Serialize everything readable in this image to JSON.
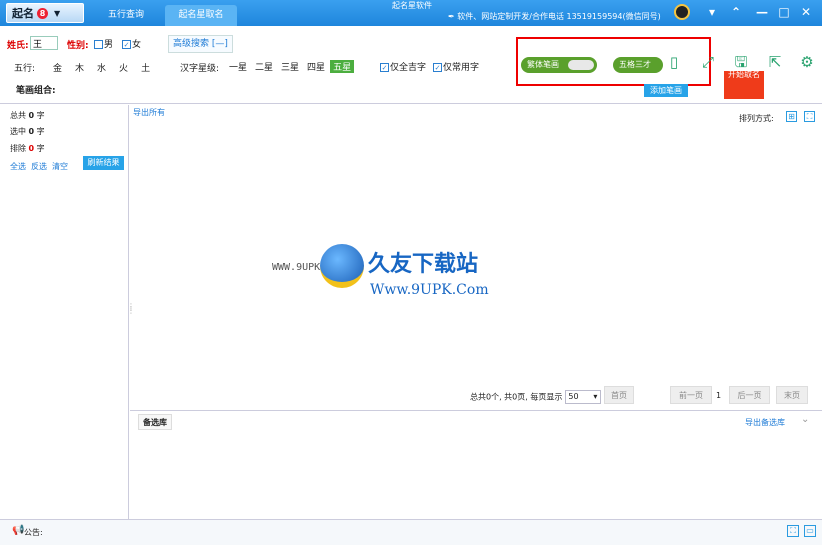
{
  "titlebar": {
    "logo_text": "起名",
    "logo_badge": "8",
    "tabs": [
      "五行查询",
      "起名星取名"
    ],
    "app_name": "起名星软件",
    "contact": "软件、网站定制开发/合作电话 13519159594(微信同号)",
    "controls": {
      "menu": "▾",
      "up": "⌃",
      "min": "—",
      "max": "□",
      "close": "✕"
    }
  },
  "form": {
    "surname_label": "姓氏:",
    "surname_value": "王",
    "gender_label": "性别:",
    "gender_male": "男",
    "gender_female": "女",
    "advanced": "高级搜索 [—]",
    "wuxing_label": "五行:",
    "wuxing": [
      "金",
      "木",
      "水",
      "火",
      "土"
    ],
    "star_label": "汉字星级:",
    "stars": [
      "一星",
      "二星",
      "三星",
      "四星",
      "五星"
    ],
    "selected_star": "五星",
    "only_auspicious": "仅全吉字",
    "only_common": "仅常用字",
    "traditional_toggle": "繁体笔画",
    "wuge_toggle": "五格三才",
    "stroke_label": "笔画组合:",
    "add_stroke": "添加笔画",
    "start_button": "开始取名"
  },
  "right_icons": [
    "phone-icon",
    "fullscreen-icon",
    "save-icon",
    "share-icon",
    "settings-icon"
  ],
  "left_panel": {
    "total_label": "总共",
    "total": "0",
    "total_unit": "字",
    "selected_label": "选中",
    "selected": "0",
    "selected_unit": "字",
    "excluded_label": "排除",
    "excluded": "0",
    "excluded_unit": "字",
    "select_all": "全选",
    "invert": "反选",
    "clear": "清空",
    "refresh": "刷新结果"
  },
  "main": {
    "export_all": "导出所有",
    "sort_label": "排列方式:",
    "pager": {
      "summary": "总共0个, 共0页, 每页显示",
      "page_size": "50",
      "first": "首页",
      "prev": "前一页",
      "current": "1",
      "next": "后一页",
      "last": "末页"
    }
  },
  "watermark": {
    "prefix": "WWW.9UPK.COM",
    "title": "久友下载站",
    "url": "Www.9UPK.Com"
  },
  "backup": {
    "label": "备选库",
    "export": "导出备选库"
  },
  "status": {
    "announcement": "公告:"
  }
}
